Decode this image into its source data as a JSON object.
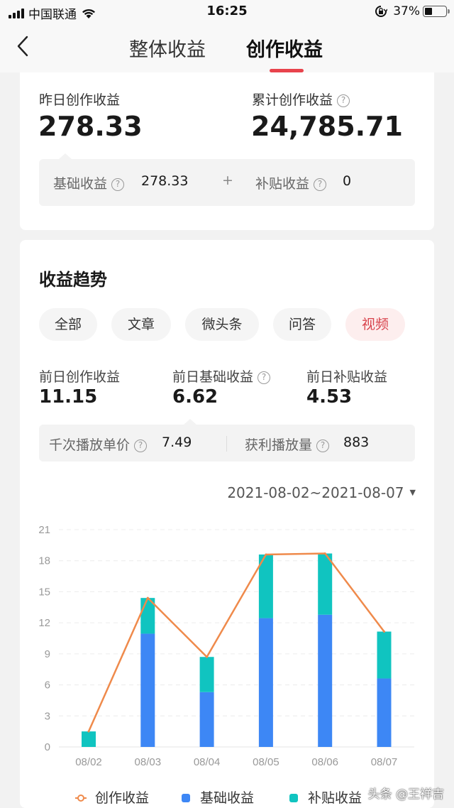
{
  "status_bar": {
    "carrier": "中国联通",
    "time": "16:25",
    "battery_percent": "37%",
    "battery_level": 0.37
  },
  "nav": {
    "back_icon": "chevron-left-icon",
    "tabs": [
      {
        "label": "整体收益",
        "active": false
      },
      {
        "label": "创作收益",
        "active": true
      }
    ],
    "accent_color": "#e8434c"
  },
  "summary": {
    "yesterday_label": "昨日创作收益",
    "yesterday_value": "278.33",
    "total_label": "累计创作收益",
    "total_value": "24,785.71",
    "base_label": "基础收益",
    "base_value": "278.33",
    "plus": "+",
    "subsidy_label": "补贴收益",
    "subsidy_value": "0",
    "help_icon": "?"
  },
  "trend": {
    "title": "收益趋势",
    "filters": [
      {
        "label": "全部",
        "active": false
      },
      {
        "label": "文章",
        "active": false
      },
      {
        "label": "微头条",
        "active": false
      },
      {
        "label": "问答",
        "active": false
      },
      {
        "label": "视频",
        "active": true
      }
    ],
    "metrics": [
      {
        "label": "前日创作收益",
        "value": "11.15",
        "help": false
      },
      {
        "label": "前日基础收益",
        "value": "6.62",
        "help": true
      },
      {
        "label": "前日补贴收益",
        "value": "4.53",
        "help": false
      }
    ],
    "rpm_label": "千次播放单价",
    "rpm_value": "7.49",
    "plays_label": "获利播放量",
    "plays_value": "883",
    "date_range": "2021-08-02~2021-08-07"
  },
  "chart_data": {
    "type": "bar",
    "stacked": true,
    "title": "",
    "xlabel": "",
    "ylabel": "",
    "categories": [
      "08/02",
      "08/03",
      "08/04",
      "08/05",
      "08/06",
      "08/07"
    ],
    "ylim": [
      0,
      21
    ],
    "yticks": [
      0,
      3,
      6,
      9,
      12,
      15,
      18,
      21
    ],
    "grid": true,
    "legend_position": "bottom",
    "series": [
      {
        "name": "基础收益",
        "type": "bar",
        "color": "#3d87f5",
        "values": [
          0,
          10.95,
          5.3,
          12.45,
          12.78,
          6.62
        ]
      },
      {
        "name": "补贴收益",
        "type": "bar",
        "color": "#10c4c0",
        "values": [
          1.5,
          3.45,
          3.4,
          6.15,
          5.92,
          4.53
        ]
      },
      {
        "name": "创作收益",
        "type": "line",
        "color": "#ef8a4b",
        "values": [
          1.5,
          14.4,
          8.7,
          18.6,
          18.7,
          11.15
        ]
      }
    ]
  },
  "watermark": "头条 @王祥吉"
}
